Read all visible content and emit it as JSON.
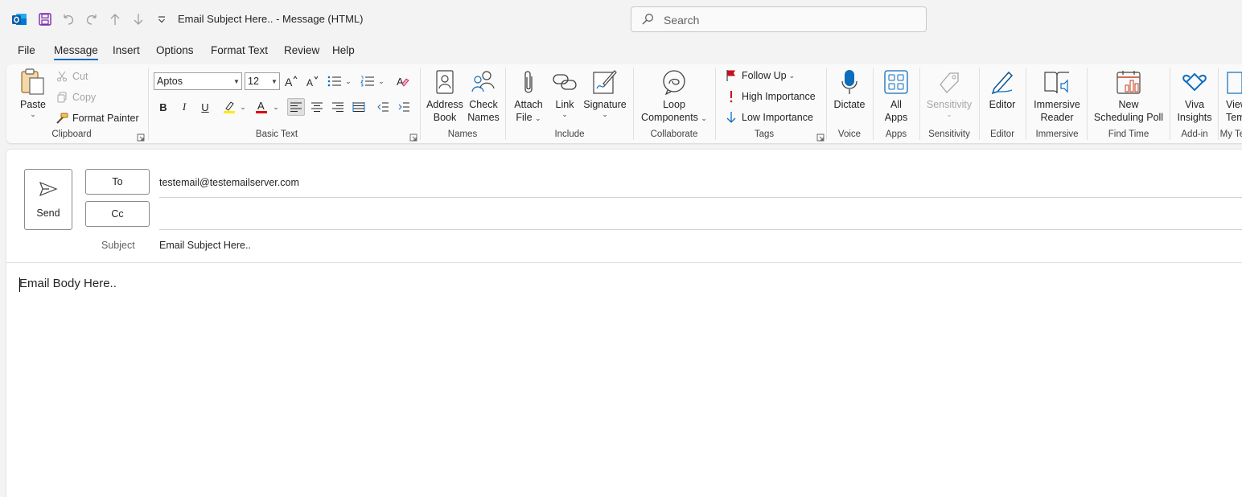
{
  "window": {
    "title": "Email Subject Here..  -  Message (HTML)"
  },
  "search": {
    "placeholder": "Search"
  },
  "tabs": [
    "File",
    "Message",
    "Insert",
    "Options",
    "Format Text",
    "Review",
    "Help"
  ],
  "active_tab": "Message",
  "ribbon": {
    "clipboard": {
      "label": "Clipboard",
      "paste": "Paste",
      "cut": "Cut",
      "copy": "Copy",
      "format_painter": "Format Painter"
    },
    "basic_text": {
      "label": "Basic Text",
      "font": "Aptos",
      "size": "12"
    },
    "names": {
      "label": "Names",
      "address_book": [
        "Address",
        "Book"
      ],
      "check_names": [
        "Check",
        "Names"
      ]
    },
    "include": {
      "label": "Include",
      "attach_file": [
        "Attach",
        "File"
      ],
      "link": "Link",
      "signature": "Signature"
    },
    "collaborate": {
      "label": "Collaborate",
      "loop": [
        "Loop",
        "Components"
      ]
    },
    "tags": {
      "label": "Tags",
      "follow_up": "Follow Up",
      "high_importance": "High Importance",
      "low_importance": "Low Importance"
    },
    "voice": {
      "label": "Voice",
      "dictate": "Dictate"
    },
    "apps": {
      "label": "Apps",
      "all_apps": [
        "All",
        "Apps"
      ]
    },
    "sensitivity": {
      "label": "Sensitivity",
      "button": "Sensitivity"
    },
    "editor": {
      "label": "Editor",
      "button": "Editor"
    },
    "immersive": {
      "label": "Immersive",
      "button": [
        "Immersive",
        "Reader"
      ]
    },
    "find_time": {
      "label": "Find Time",
      "button": [
        "New",
        "Scheduling Poll"
      ]
    },
    "addin": {
      "label": "Add-in",
      "button": [
        "Viva",
        "Insights"
      ]
    },
    "my_templates": {
      "label": "My Templates",
      "button": [
        "View",
        "Templates"
      ]
    }
  },
  "colors": {
    "accent": "#0f6cbd",
    "highlight": "#ffeb00",
    "font_color": "#e00000",
    "flag": "#c50f1f"
  },
  "compose": {
    "send": "Send",
    "to_label": "To",
    "cc_label": "Cc",
    "to_value": "testemail@testemailserver.com",
    "cc_value": "",
    "subject_label": "Subject",
    "subject_value": "Email Subject Here..",
    "body": "Email Body Here.."
  }
}
